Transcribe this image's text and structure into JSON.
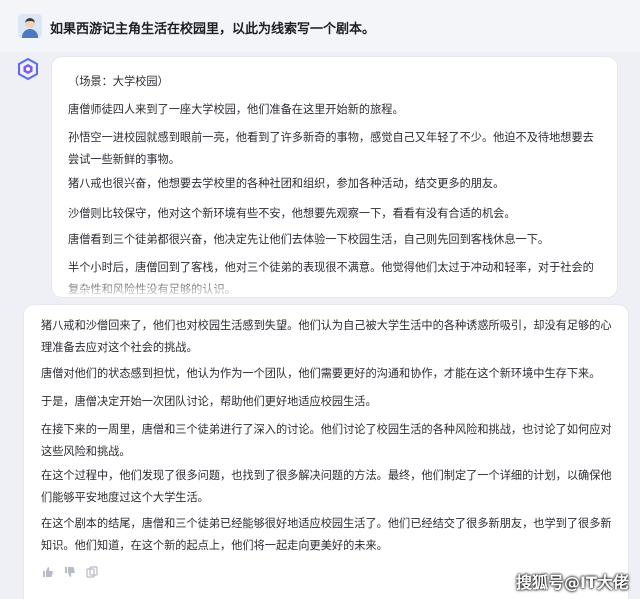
{
  "user_prompt": "如果西游记主角生活在校园里，以此为线索写一个剧本。",
  "response_part1": [
    "（场景：大学校园）",
    "唐僧师徒四人来到了一座大学校园，他们准备在这里开始新的旅程。",
    "孙悟空一进校园就感到眼前一亮，他看到了许多新奇的事物，感觉自己又年轻了不少。他迫不及待地想要去尝试一些新鲜的事物。",
    "猪八戒也很兴奋，他想要去学校里的各种社团和组织，参加各种活动，结交更多的朋友。",
    "沙僧则比较保守，他对这个新环境有些不安，他想要先观察一下，看看有没有合适的机会。",
    "唐僧看到三个徒弟都很兴奋，他决定先让他们去体验一下校园生活，自己则先回到客栈休息一下。",
    "半个小时后，唐僧回到了客栈，他对三个徒弟的表现很不满意。他觉得他们太过于冲动和轻率，对于社会的复杂性和风险性没有足够的认识。"
  ],
  "response_part2": [
    "猪八戒和沙僧回来了，他们也对校园生活感到失望。他们认为自己被大学生活中的各种诱惑所吸引，却没有足够的心理准备去应对这个社会的挑战。",
    "唐僧对他们的状态感到担忧，他认为作为一个团队，他们需要更好的沟通和协作，才能在这个新环境中生存下来。",
    "于是，唐僧决定开始一次团队讨论，帮助他们更好地适应校园生活。",
    "在接下来的一周里，唐僧和三个徒弟进行了深入的讨论。他们讨论了校园生活的各种风险和挑战，也讨论了如何应对这些风险和挑战。",
    "在这个过程中，他们发现了很多问题，也找到了很多解决问题的方法。最终，他们制定了一个详细的计划，以确保他们能够平安地度过这个大学生活。",
    "在这个剧本的结尾，唐僧和三个徒弟已经能够很好地适应校园生活了。他们已经结交了很多新朋友，也学到了很多新知识。他们知道，在这个新的起点上，他们将一起走向更美好的未来。"
  ],
  "watermark": "搜狐号@IT大佬",
  "icons": [
    "user-avatar",
    "bot-logo",
    "thumbs-up-icon",
    "thumbs-down-icon",
    "copy-icon"
  ]
}
